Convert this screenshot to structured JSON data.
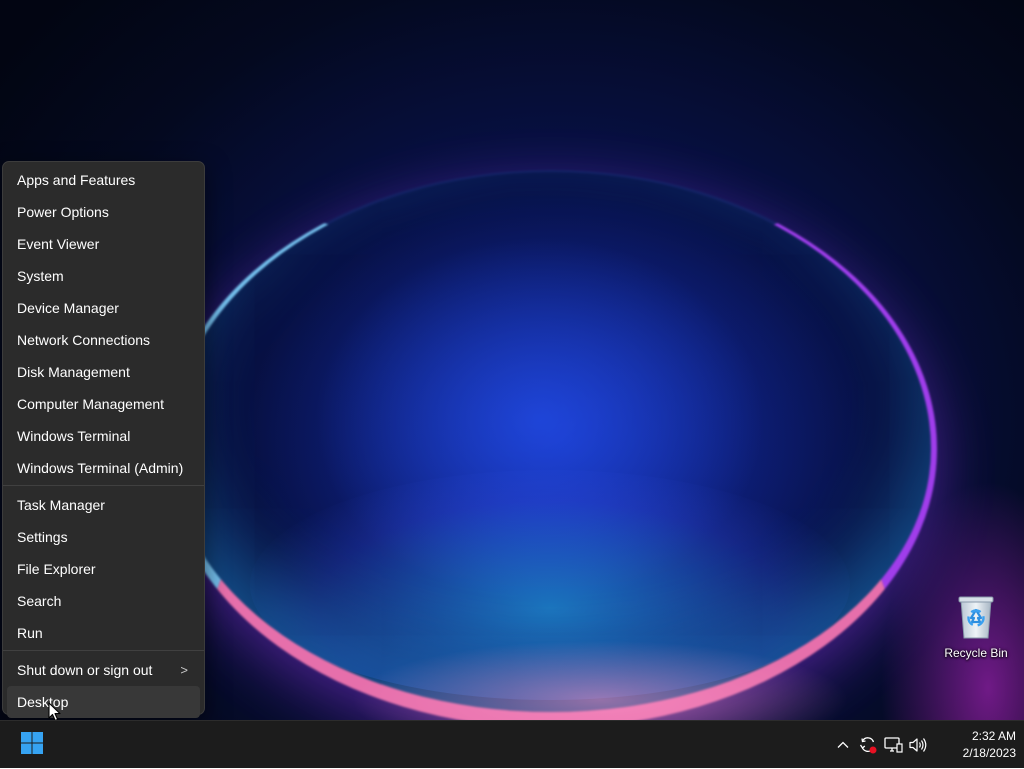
{
  "desktop": {
    "recycle_bin_label": "Recycle Bin"
  },
  "context_menu": {
    "group1": [
      {
        "label": "Apps and Features"
      },
      {
        "label": "Power Options"
      },
      {
        "label": "Event Viewer"
      },
      {
        "label": "System"
      },
      {
        "label": "Device Manager"
      },
      {
        "label": "Network Connections"
      },
      {
        "label": "Disk Management"
      },
      {
        "label": "Computer Management"
      },
      {
        "label": "Windows Terminal"
      },
      {
        "label": "Windows Terminal (Admin)"
      }
    ],
    "group2": [
      {
        "label": "Task Manager"
      },
      {
        "label": "Settings"
      },
      {
        "label": "File Explorer"
      },
      {
        "label": "Search"
      },
      {
        "label": "Run"
      }
    ],
    "group3": [
      {
        "label": "Shut down or sign out",
        "submenu_arrow": ">"
      },
      {
        "label": "Desktop",
        "active": true
      }
    ]
  },
  "taskbar": {
    "start_icon": "windows-logo-icon",
    "accent_color": "#36a3f2",
    "tray_icons": [
      "chevron-up-icon",
      "sync-alert-icon",
      "network-icon",
      "volume-icon"
    ],
    "alert_dot_color": "#e81123",
    "clock": {
      "time": "2:32 AM",
      "date": "2/18/2023"
    }
  }
}
